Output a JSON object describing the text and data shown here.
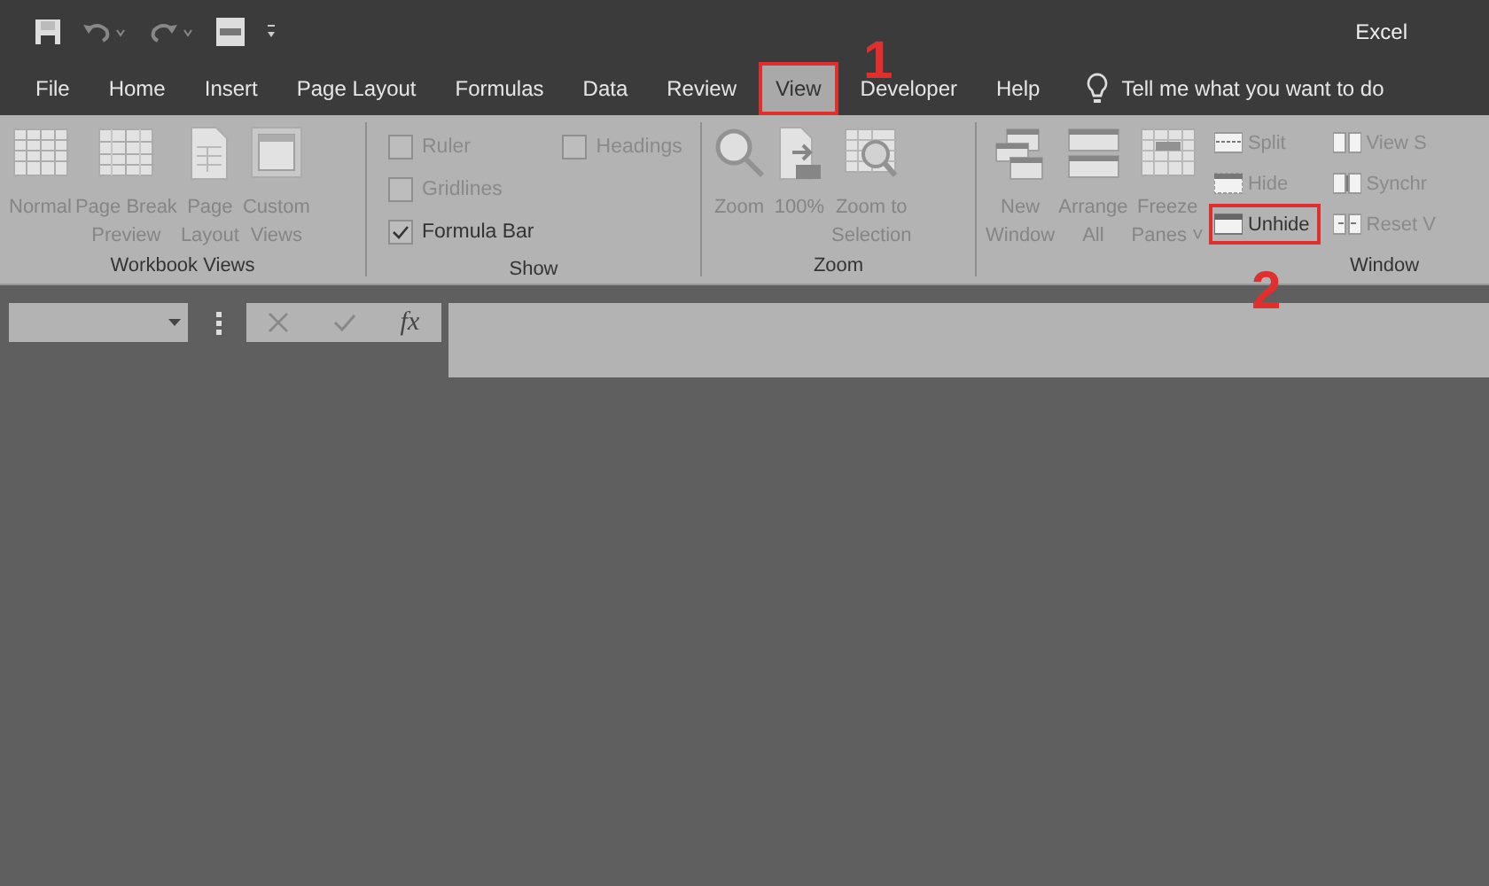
{
  "title_bar": {
    "app_name": "Excel"
  },
  "tabs": [
    {
      "label": "File",
      "selected": false,
      "highlighted": false
    },
    {
      "label": "Home",
      "selected": false,
      "highlighted": false
    },
    {
      "label": "Insert",
      "selected": false,
      "highlighted": false
    },
    {
      "label": "Page Layout",
      "selected": false,
      "highlighted": false
    },
    {
      "label": "Formulas",
      "selected": false,
      "highlighted": false
    },
    {
      "label": "Data",
      "selected": false,
      "highlighted": false
    },
    {
      "label": "Review",
      "selected": false,
      "highlighted": false
    },
    {
      "label": "View",
      "selected": true,
      "highlighted": true
    },
    {
      "label": "Developer",
      "selected": false,
      "highlighted": false
    },
    {
      "label": "Help",
      "selected": false,
      "highlighted": false
    }
  ],
  "tell_me": {
    "placeholder": "Tell me what you want to do"
  },
  "ribbon": {
    "groups": [
      {
        "label": "Workbook Views",
        "items": [
          {
            "kind": "large",
            "label": "Normal",
            "disabled": true
          },
          {
            "kind": "large",
            "label": "Page Break\nPreview",
            "disabled": true
          },
          {
            "kind": "large",
            "label": "Page\nLayout",
            "disabled": true
          },
          {
            "kind": "large",
            "label": "Custom\nViews",
            "disabled": true
          }
        ]
      },
      {
        "label": "Show",
        "items": [
          {
            "kind": "checkbox",
            "label": "Ruler",
            "checked": false,
            "disabled": true
          },
          {
            "kind": "checkbox",
            "label": "Gridlines",
            "checked": false,
            "disabled": true
          },
          {
            "kind": "checkbox",
            "label": "Formula Bar",
            "checked": true,
            "disabled": false
          },
          {
            "kind": "checkbox",
            "label": "Headings",
            "checked": false,
            "disabled": true
          }
        ]
      },
      {
        "label": "Zoom",
        "items": [
          {
            "kind": "large",
            "label": "Zoom",
            "disabled": true
          },
          {
            "kind": "large",
            "label": "100%",
            "disabled": true
          },
          {
            "kind": "large",
            "label": "Zoom to\nSelection",
            "disabled": true
          }
        ]
      },
      {
        "label": "Window",
        "items": [
          {
            "kind": "large",
            "label": "New\nWindow",
            "disabled": true
          },
          {
            "kind": "large",
            "label": "Arrange\nAll",
            "disabled": true
          },
          {
            "kind": "large",
            "label": "Freeze\nPanes",
            "caret": "˅",
            "disabled": true
          },
          {
            "kind": "small",
            "label": "Split",
            "disabled": true,
            "highlighted": false
          },
          {
            "kind": "small",
            "label": "Hide",
            "disabled": true,
            "highlighted": false
          },
          {
            "kind": "small",
            "label": "Unhide",
            "disabled": false,
            "highlighted": true
          },
          {
            "kind": "small",
            "label": "View S",
            "disabled": true,
            "highlighted": false
          },
          {
            "kind": "small",
            "label": "Synchr",
            "disabled": true,
            "highlighted": false
          },
          {
            "kind": "small",
            "label": "Reset V",
            "disabled": true,
            "highlighted": false
          }
        ]
      }
    ]
  },
  "formula_bar": {
    "function_label": "fx"
  },
  "annotations": [
    {
      "label": "1"
    },
    {
      "label": "2"
    }
  ]
}
